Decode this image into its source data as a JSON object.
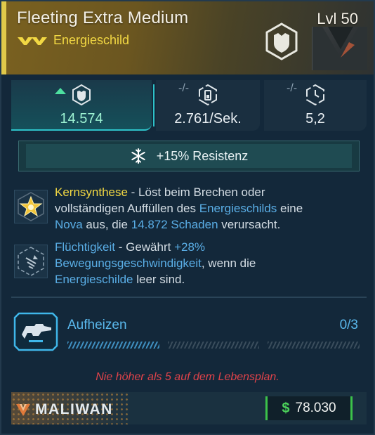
{
  "item": {
    "name": "Fleeting Extra Medium",
    "level": "Lvl 50",
    "type": "Energieschild",
    "rarity_color": "#f2d843"
  },
  "stats": [
    {
      "icon": "shield-capacity-icon",
      "prefix": "",
      "value": "14.574",
      "highlight": true
    },
    {
      "icon": "recharge-rate-icon",
      "prefix": "-/-",
      "value": "2.761/Sek."
    },
    {
      "icon": "recharge-delay-icon",
      "prefix": "-/-",
      "value": "5,2"
    }
  ],
  "resistance": {
    "icon": "snowflake-icon",
    "text": "+15% Resistenz"
  },
  "perks": [
    {
      "icon": "kernsynthese-star-icon",
      "lines": [
        [
          "Kernsynthese",
          " - Löst beim Brechen oder"
        ],
        [
          "vollständigen Auffüllen des ",
          "Energieschilds",
          " eine"
        ],
        [
          "Nova",
          " aus, die ",
          "14.872 Schaden",
          " verursacht."
        ]
      ]
    },
    {
      "icon": "fluechtigkeit-dash-icon",
      "lines": [
        [
          "Flüchtigkeit",
          " - Gewährt ",
          "+28%"
        ],
        [
          "Bewegungsgeschwindigkeit",
          ", wenn die"
        ],
        [
          "Energieschilde",
          " leer sind."
        ]
      ]
    }
  ],
  "heat": {
    "label": "Aufheizen",
    "count": "0/3",
    "progress": 0
  },
  "warning": "Nie höher als 5 auf dem Lebensplan.",
  "footer": {
    "brand": "MALIWAN",
    "currency_symbol": "$",
    "price": "78.030"
  }
}
